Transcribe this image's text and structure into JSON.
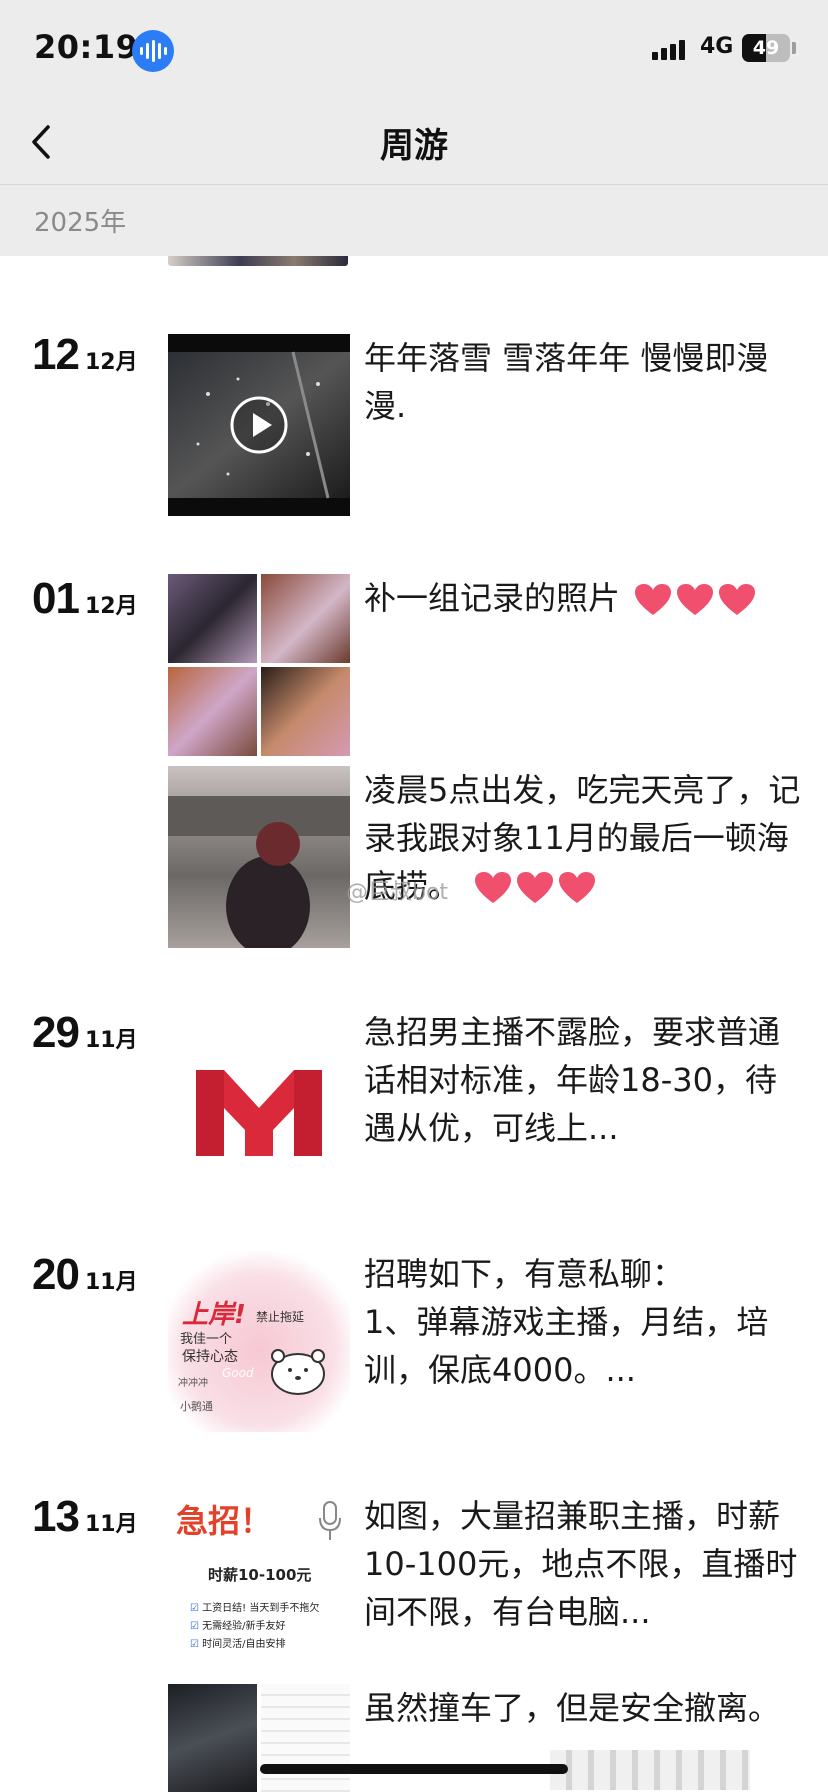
{
  "status_bar": {
    "time": "20:19",
    "network": "4G",
    "battery": "49",
    "battery_level": 0.49
  },
  "header": {
    "title": "周游",
    "year": "2025年"
  },
  "watermark": "@巨叔bot",
  "posts": [
    {
      "day": "12",
      "month": "12月",
      "media": "video",
      "text": "年年落雪 雪落年年 慢慢即漫漫."
    },
    {
      "day": "01",
      "month": "12月",
      "media": "photo-grid",
      "text": "补一组记录的照片"
    },
    {
      "day": "",
      "month": "",
      "media": "photo",
      "text": "凌晨5点出发，吃完天亮了，记录我跟对象11月的最后一顿海底捞。"
    },
    {
      "day": "29",
      "month": "11月",
      "media": "logo",
      "text": "急招男主播不露脸，要求普通话相对标准，年龄18-30，待遇从优，可线上..."
    },
    {
      "day": "20",
      "month": "11月",
      "media": "sticker",
      "text": "招聘如下，有意私聊：\n1、弹幕游戏主播，月结，培训，保底4000。..."
    },
    {
      "day": "13",
      "month": "11月",
      "media": "poster",
      "text": "如图，大量招兼职主播，时薪10-100元，地点不限，直播时间不限，有台电脑..."
    },
    {
      "day": "",
      "month": "",
      "media": "photo-pair",
      "text": "虽然撞车了，但是安全撤离。"
    }
  ],
  "poster": {
    "headline": "急招！",
    "wage": "时薪10-100元",
    "bullets": [
      "工资日结! 当天到手不拖欠",
      "无需经验/新手友好",
      "时间灵活/自由安排"
    ]
  },
  "sticker": {
    "big": "上岸!",
    "line1": "我佳一个",
    "line2": "保持心态",
    "line3": "禁止拖延",
    "good": "Good",
    "footer": "冲冲冲",
    "brand": "小鹅通"
  },
  "colors": {
    "heart": "#f0506e",
    "logo_red": "#d9293a",
    "voice_blue": "#2b7cf5",
    "header_bg": "#ececec"
  }
}
